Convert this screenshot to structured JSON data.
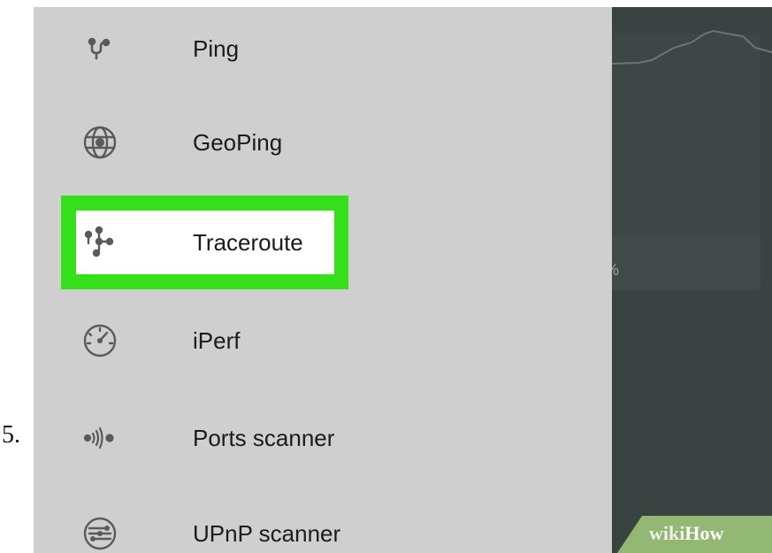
{
  "step_number": "5.",
  "menu": {
    "items": [
      {
        "label": "Ping",
        "icon": "ping-icon"
      },
      {
        "label": "GeoPing",
        "icon": "globe-icon"
      },
      {
        "label": "Traceroute",
        "icon": "traceroute-icon"
      },
      {
        "label": "iPerf",
        "icon": "speedometer-icon"
      },
      {
        "label": "Ports scanner",
        "icon": "ports-scanner-icon"
      },
      {
        "label": "UPnP scanner",
        "icon": "upnp-icon"
      }
    ],
    "highlighted": "Traceroute"
  },
  "background": {
    "percent_fragment": "%"
  },
  "watermark": {
    "part1": "wiki",
    "part2": "How"
  },
  "colors": {
    "drawer": "#cfcfcf",
    "highlight": "#35e01b",
    "icon": "#5a5a5a",
    "text": "#1b1b1b",
    "backdrop": "#363f3d"
  }
}
